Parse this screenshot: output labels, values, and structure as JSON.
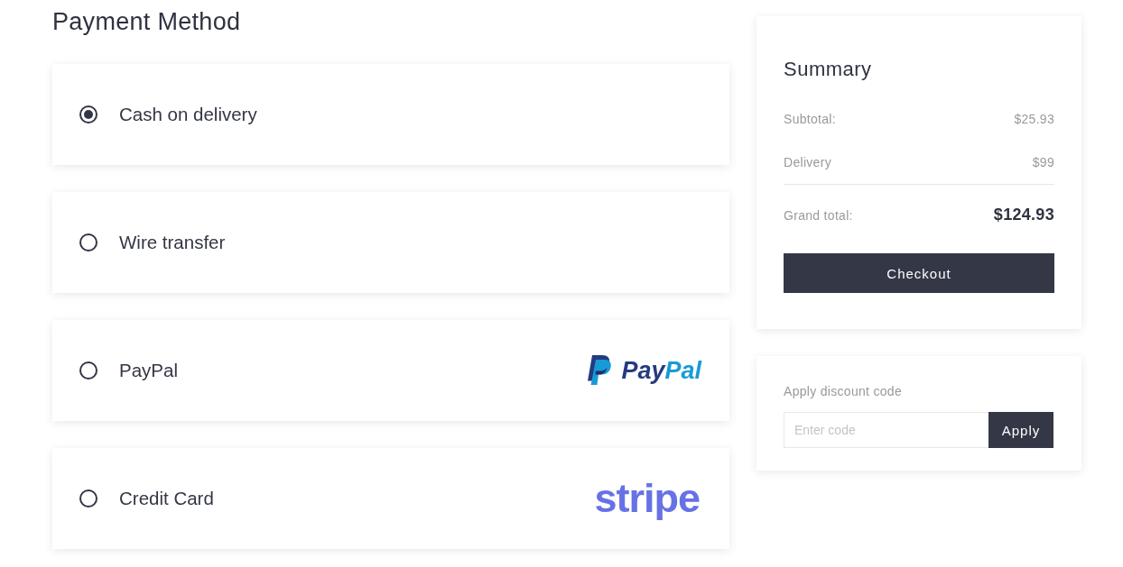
{
  "page_title": "Payment Method",
  "payment_methods": [
    {
      "label": "Cash on delivery",
      "selected": true,
      "kind": "plain"
    },
    {
      "label": "Wire transfer",
      "selected": false,
      "kind": "plain"
    },
    {
      "label": "PayPal",
      "selected": false,
      "kind": "paypal",
      "logo_parts": [
        "Pay",
        "Pal"
      ]
    },
    {
      "label": "Credit Card",
      "selected": false,
      "kind": "stripe",
      "logo_parts": [
        "stripe"
      ]
    }
  ],
  "summary": {
    "title": "Summary",
    "rows": [
      {
        "label": "Subtotal:",
        "value": "$25.93",
        "kind": "line"
      },
      {
        "label": "Delivery",
        "value": "$99",
        "kind": "line"
      },
      {
        "label": "Grand total:",
        "value": "$124.93",
        "kind": "total"
      }
    ],
    "button": "Checkout"
  },
  "discount": {
    "label": "Apply discount code",
    "placeholder": "Enter code",
    "button": "Apply"
  }
}
